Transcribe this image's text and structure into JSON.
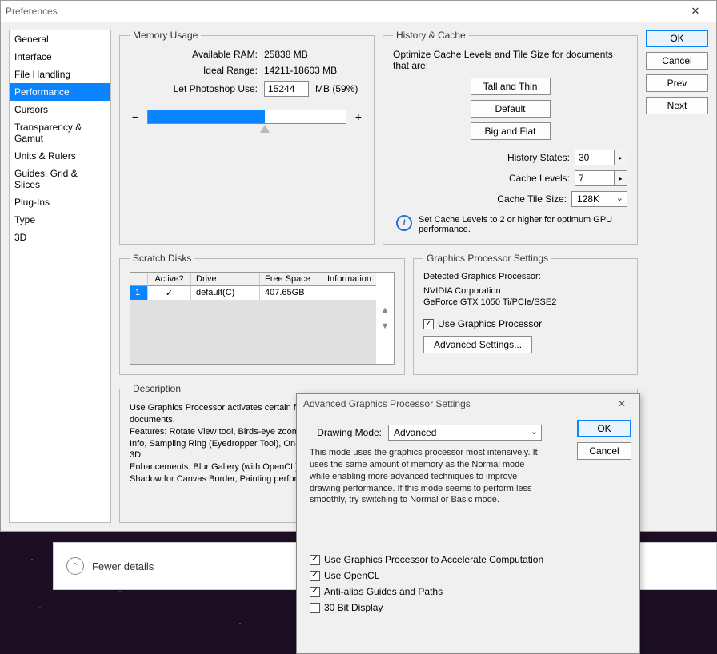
{
  "window": {
    "title": "Preferences"
  },
  "sidebar": {
    "items": [
      "General",
      "Interface",
      "File Handling",
      "Performance",
      "Cursors",
      "Transparency & Gamut",
      "Units & Rulers",
      "Guides, Grid & Slices",
      "Plug-Ins",
      "Type",
      "3D"
    ],
    "selected_index": 3
  },
  "buttons": {
    "ok": "OK",
    "cancel": "Cancel",
    "prev": "Prev",
    "next": "Next"
  },
  "memory": {
    "legend": "Memory Usage",
    "available_label": "Available RAM:",
    "available_value": "25838 MB",
    "ideal_label": "Ideal Range:",
    "ideal_value": "14211-18603 MB",
    "use_label": "Let Photoshop Use:",
    "use_value": "15244",
    "use_suffix": "MB (59%)",
    "minus": "−",
    "plus": "+"
  },
  "history": {
    "legend": "History & Cache",
    "intro": "Optimize Cache Levels and Tile Size for documents that are:",
    "btn_tall": "Tall and Thin",
    "btn_default": "Default",
    "btn_big": "Big and Flat",
    "states_label": "History States:",
    "states_value": "30",
    "levels_label": "Cache Levels:",
    "levels_value": "7",
    "tile_label": "Cache Tile Size:",
    "tile_value": "128K",
    "info_text": "Set Cache Levels to 2 or higher for optimum GPU performance."
  },
  "scratch": {
    "legend": "Scratch Disks",
    "cols": {
      "active": "Active?",
      "drive": "Drive",
      "free": "Free Space",
      "info": "Information"
    },
    "row": {
      "idx": "1",
      "active": "✓",
      "drive": "default(C)",
      "free": "407.65GB",
      "info": ""
    }
  },
  "gpu": {
    "legend": "Graphics Processor Settings",
    "detected_label": "Detected Graphics Processor:",
    "vendor": "NVIDIA Corporation",
    "card": "GeForce GTX 1050 Ti/PCIe/SSE2",
    "use_label": "Use Graphics Processor",
    "advanced_btn": "Advanced Settings..."
  },
  "desc": {
    "legend": "Description",
    "text": "Use Graphics Processor activates certain features and interface enhancements. It does not enable OpenGL for already open documents.\nFeatures: Rotate View tool, Birds-eye zooming, Pixel Grid, Flick Panning, Scrubby Zoom, HUD Color Picker and Rich Cursor Info, Sampling Ring (Eyedropper Tool), On-Canvas Brush resizing, Bristle Tip Preview, Adaptive Wide Angle, Liquify\n3D\nEnhancements: Blur Gallery (with OpenCL), Smart Sharpen (noise reduction with OpenCL), Smooth Pan and Zoom, Drop Shadow for Canvas Border, Painting performance, Transform/Warp"
  },
  "adv": {
    "title": "Advanced Graphics Processor Settings",
    "mode_label": "Drawing Mode:",
    "mode_value": "Advanced",
    "desc": "This mode uses the graphics processor most intensively. It uses the same amount of memory as the Normal mode while enabling more advanced techniques to improve drawing performance. If this mode seems to perform less smoothly, try switching to Normal or Basic mode.",
    "ok": "OK",
    "cancel": "Cancel",
    "checks": {
      "accel": "Use Graphics Processor to Accelerate Computation",
      "opencl": "Use OpenCL",
      "aa": "Anti-alias Guides and Paths",
      "bit30": "30 Bit Display"
    }
  },
  "task": {
    "label": "Fewer details"
  }
}
